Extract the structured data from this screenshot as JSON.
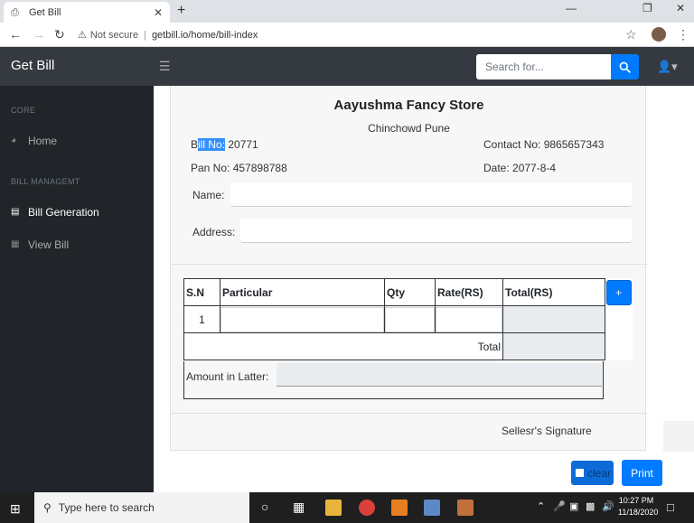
{
  "browser": {
    "tab_title": "Get Bill",
    "new_tab": "+",
    "not_secure": "Not secure",
    "url": "getbill.io/home/bill-index"
  },
  "navbar": {
    "brand": "Get Bill",
    "search_placeholder": "Search for..."
  },
  "sidebar": {
    "core_heading": "CORE",
    "home_label": "Home",
    "bill_heading": "BILL MANAGEMT",
    "bill_generation_label": "Bill Generation",
    "view_bill_label": "View Bill"
  },
  "bill": {
    "store_name": "Aayushma Fancy Store",
    "store_location": "Chinchowd Pune",
    "bill_no_prefix": "B",
    "bill_no_highlight": "ill No:",
    "bill_no_value": " 20771",
    "contact": "Contact No: 9865657343",
    "pan": "Pan No: 457898788",
    "date": "Date:  2077-8-4",
    "name_label": "Name:",
    "address_label": "Address:",
    "table": {
      "headers": [
        "S.N",
        "Particular",
        "Qty",
        "Rate(RS)",
        "Total(RS)"
      ],
      "rows": [
        {
          "sn": "1"
        }
      ],
      "total_label": "Total",
      "add_button": "+"
    },
    "amount_label": "Amount in Latter:",
    "signature": "Sellesr's Signature"
  },
  "actions": {
    "clear_label": "clear",
    "print_label": "Print"
  },
  "taskbar": {
    "search_text": "Type here to search",
    "time": "10:27 PM",
    "date": "11/18/2020"
  },
  "colors": {
    "navbar": "#343a40",
    "sidebar": "#212529",
    "primary": "#007bff"
  }
}
